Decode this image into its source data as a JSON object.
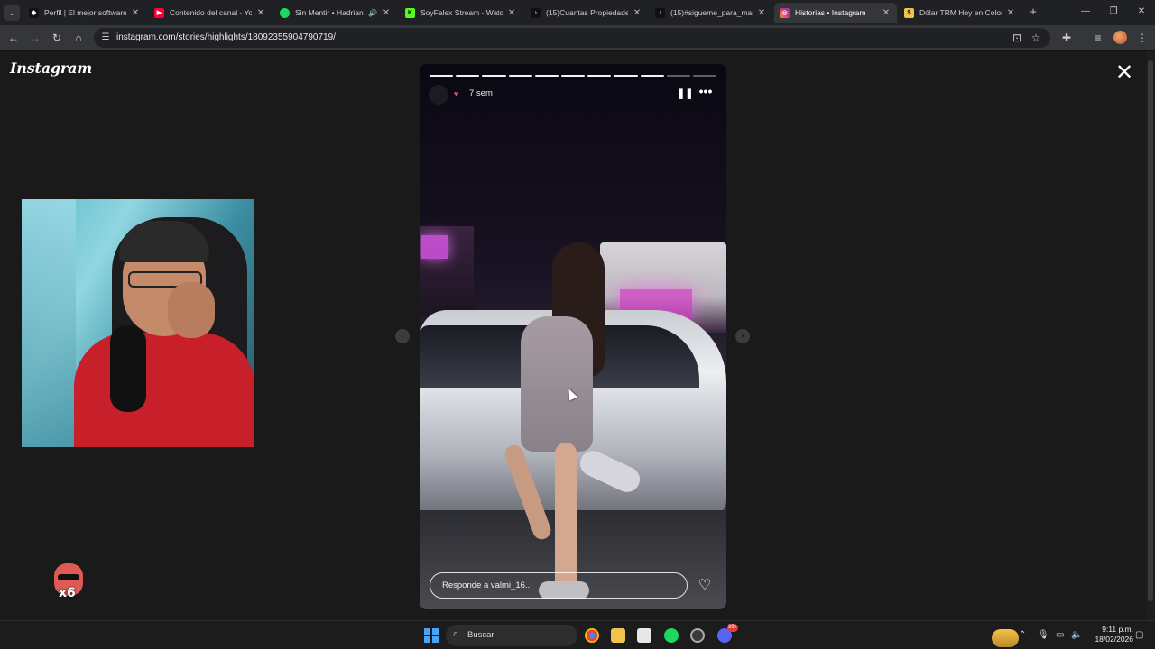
{
  "browser": {
    "tabs": [
      {
        "title": "Perfil | El mejor software p",
        "favicon": "diamond-icon",
        "color": "#ffffff",
        "active": false
      },
      {
        "title": "Contenido del canal - You",
        "favicon": "youtube-icon",
        "color": "#ff0033",
        "active": false
      },
      {
        "title": "Sin Mentir • Hadrian",
        "favicon": "spotify-icon",
        "color": "#1ed760",
        "active": false,
        "audio": true
      },
      {
        "title": "SoyFalex Stream - Watch",
        "favicon": "kick-icon",
        "color": "#53fc18",
        "active": false
      },
      {
        "title": "(15)Cuantas Propiedades",
        "favicon": "tiktok-icon",
        "color": "#ffffff",
        "active": false
      },
      {
        "title": "(15)#sigueme_para_mas_",
        "favicon": "tiktok-icon",
        "color": "#ffffff",
        "active": false
      },
      {
        "title": "Historias • Instagram",
        "favicon": "instagram-icon",
        "color": "#e1306c",
        "active": true
      },
      {
        "title": "Dólar TRM Hoy en Colom",
        "favicon": "coin-icon",
        "color": "#f2c14e",
        "active": false
      }
    ],
    "url": "instagram.com/stories/highlights/18092355904790719/",
    "speaker_glyph": "🔊"
  },
  "instagram": {
    "logo": "Instagram",
    "close_glyph": "✕"
  },
  "story": {
    "time_ago": "7 sem",
    "progress_total": 11,
    "progress_done": 9,
    "reply_placeholder": "Responde a valmi_16...",
    "pause_glyph": "❚❚",
    "more_glyph": "•••",
    "like_glyph": "♡"
  },
  "overlay": {
    "emote_text": "x6"
  },
  "taskbar": {
    "search_label": "Buscar",
    "time": "9:11 p.m.",
    "date": "18/02/2026",
    "notification_badge": "99+",
    "accent": "#4aa3f5"
  }
}
